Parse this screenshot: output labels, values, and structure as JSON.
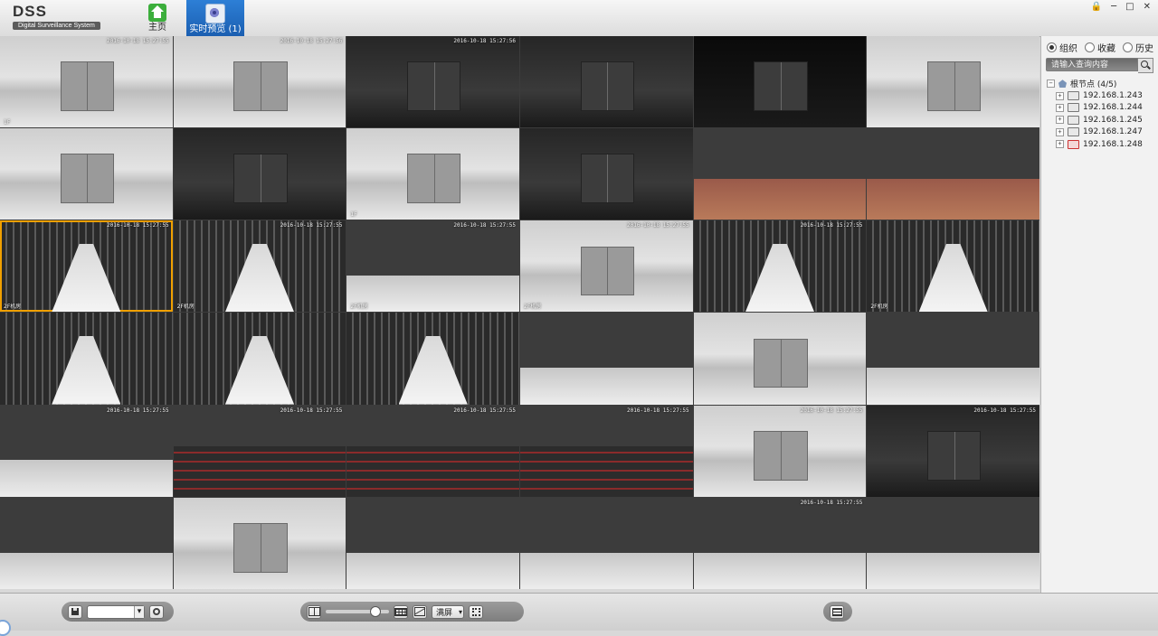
{
  "app": {
    "title": "DSS",
    "subtitle": "Digital Surveillance System"
  },
  "nav": {
    "home_label": "主页",
    "live_label": "实时预览 (1)"
  },
  "window_controls": {
    "lock": "🔒",
    "minimize": "─",
    "maximize": "□",
    "close": "✕"
  },
  "panel": {
    "radios": [
      {
        "label": "组织",
        "checked": true
      },
      {
        "label": "收藏",
        "checked": false
      },
      {
        "label": "历史",
        "checked": false
      }
    ],
    "search_placeholder": "请输入查询内容",
    "tree": {
      "root_label": "根节点 (4/5)",
      "devices": [
        {
          "label": "192.168.1.243",
          "online": true
        },
        {
          "label": "192.168.1.244",
          "online": true
        },
        {
          "label": "192.168.1.245",
          "online": true
        },
        {
          "label": "192.168.1.247",
          "online": true
        },
        {
          "label": "192.168.1.248",
          "online": false
        }
      ]
    }
  },
  "toolbar": {
    "fullscreen_label": "满屏"
  },
  "video_grid": {
    "cells": [
      {
        "style": "light",
        "ts": "2016-10-18 15:27:55",
        "name": "1F"
      },
      {
        "style": "light",
        "ts": "2016-10-18 15:27:56",
        "name": ""
      },
      {
        "style": "dark",
        "ts": "2016-10-18 15:27:56",
        "name": ""
      },
      {
        "style": "dark",
        "ts": "",
        "name": ""
      },
      {
        "style": "black",
        "ts": "",
        "name": ""
      },
      {
        "style": "light",
        "ts": "",
        "name": ""
      },
      {
        "style": "light",
        "ts": "",
        "name": ""
      },
      {
        "style": "dark",
        "ts": "",
        "name": ""
      },
      {
        "style": "light",
        "ts": "",
        "name": "1F"
      },
      {
        "style": "dark",
        "ts": "",
        "name": ""
      },
      {
        "style": "red",
        "ts": "",
        "name": ""
      },
      {
        "style": "red",
        "ts": "",
        "name": ""
      },
      {
        "style": "rack",
        "ts": "2016-10-18 15:27:55",
        "name": "2F机房"
      },
      {
        "style": "rack",
        "ts": "2016-10-18 15:27:55",
        "name": "2F机房"
      },
      {
        "style": "hall",
        "ts": "2016-10-18 15:27:55",
        "name": "2F机房"
      },
      {
        "style": "light",
        "ts": "2016-10-18 15:27:55",
        "name": "2F机房"
      },
      {
        "style": "rack",
        "ts": "2016-10-18 15:27:55",
        "name": ""
      },
      {
        "style": "rack",
        "ts": "",
        "name": "2F机房"
      },
      {
        "style": "rack",
        "ts": "",
        "name": ""
      },
      {
        "style": "rack",
        "ts": "",
        "name": ""
      },
      {
        "style": "rack",
        "ts": "",
        "name": ""
      },
      {
        "style": "hall",
        "ts": "",
        "name": ""
      },
      {
        "style": "light",
        "ts": "",
        "name": ""
      },
      {
        "style": "hall",
        "ts": "",
        "name": ""
      },
      {
        "style": "hall",
        "ts": "2016-10-18 15:27:55",
        "name": ""
      },
      {
        "style": "battery",
        "ts": "2016-10-18 15:27:55",
        "name": ""
      },
      {
        "style": "battery",
        "ts": "2016-10-18 15:27:55",
        "name": ""
      },
      {
        "style": "battery",
        "ts": "2016-10-18 15:27:55",
        "name": ""
      },
      {
        "style": "light",
        "ts": "2016-10-18 15:27:55",
        "name": ""
      },
      {
        "style": "dark",
        "ts": "2016-10-18 15:27:55",
        "name": ""
      },
      {
        "style": "hall",
        "ts": "",
        "name": ""
      },
      {
        "style": "light",
        "ts": "",
        "name": ""
      },
      {
        "style": "hall",
        "ts": "",
        "name": ""
      },
      {
        "style": "hall",
        "ts": "",
        "name": ""
      },
      {
        "style": "hall",
        "ts": "2016-10-18 15:27:55",
        "name": ""
      },
      {
        "style": "hall",
        "ts": "",
        "name": ""
      }
    ]
  }
}
